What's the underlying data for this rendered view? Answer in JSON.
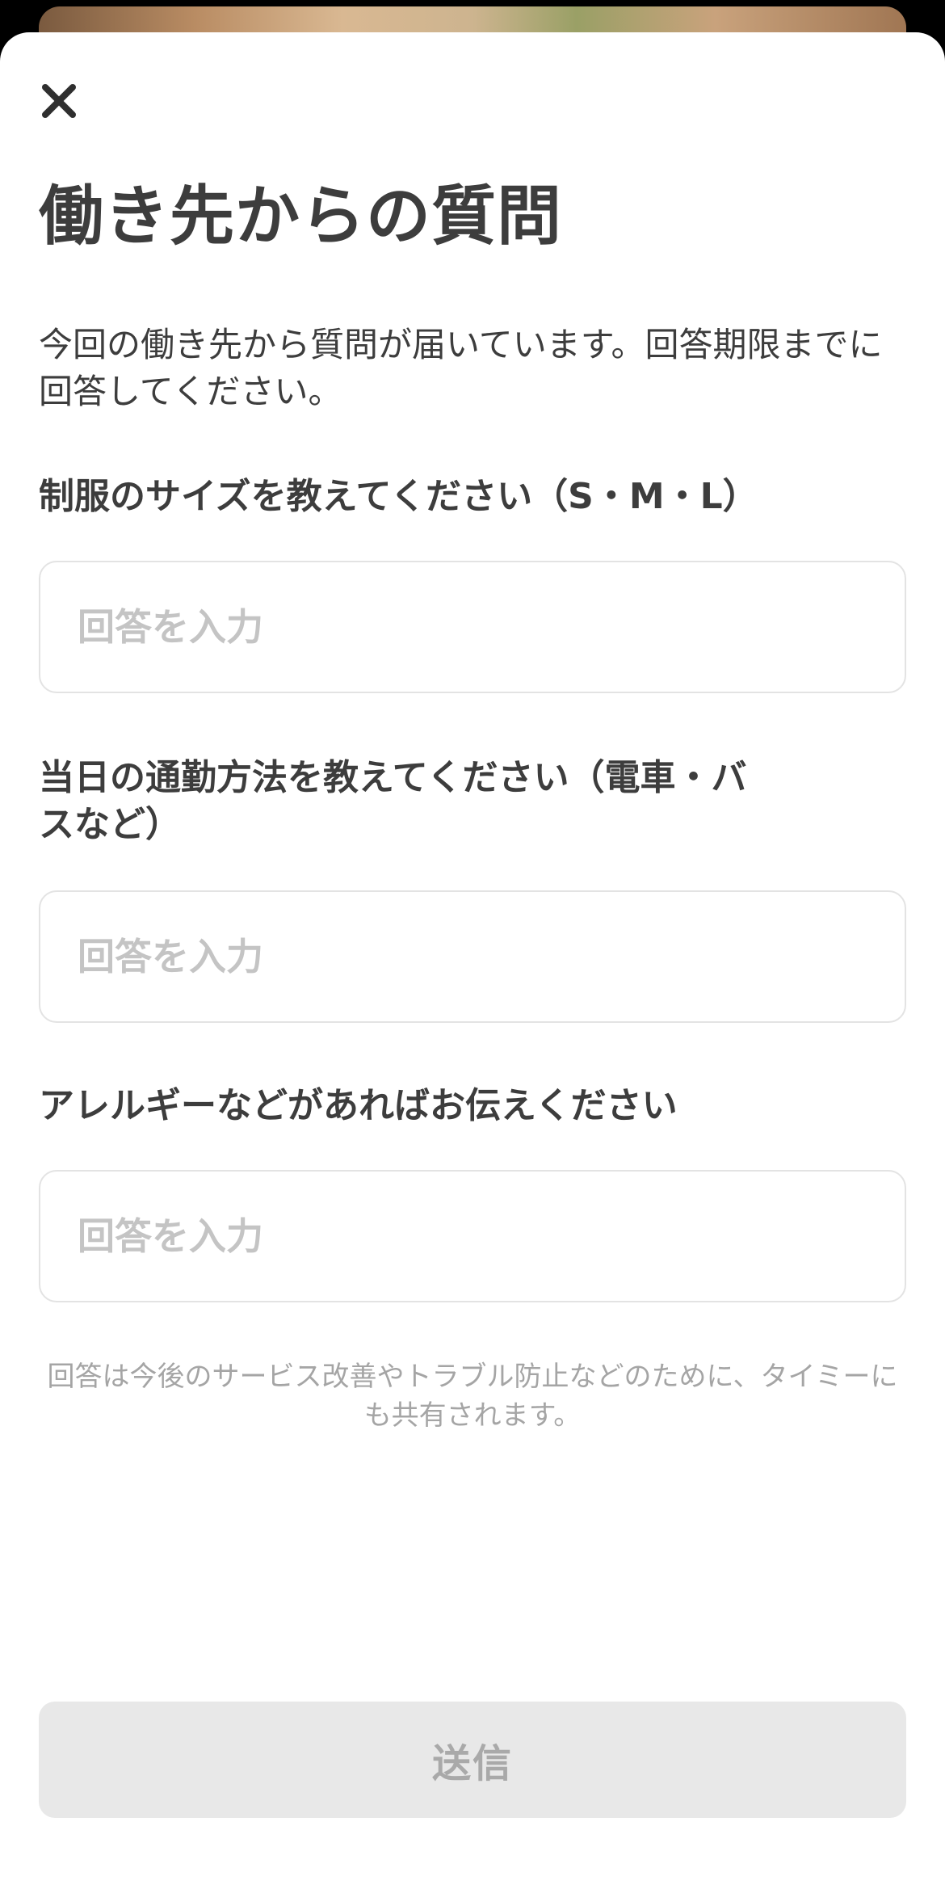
{
  "sheet": {
    "close_icon": "close-icon",
    "title": "働き先からの質問",
    "intro": "今回の働き先から質問が届いています。回答期限までに回答してください。"
  },
  "questions": [
    {
      "label": "制服のサイズを教えてください（S・M・L）",
      "placeholder": "回答を入力",
      "value": ""
    },
    {
      "label": "当日の通勤方法を教えてください（電車・バスなど）",
      "placeholder": "回答を入力",
      "value": ""
    },
    {
      "label": "アレルギーなどがあればお伝えください",
      "placeholder": "回答を入力",
      "value": ""
    }
  ],
  "notice": "回答は今後のサービス改善やトラブル防止などのために、タイミーにも共有されます。",
  "submit": {
    "label": "送信",
    "enabled": false
  },
  "colors": {
    "text": "#3d3d3d",
    "placeholder": "#c4c4c4",
    "notice": "#a5a5a5",
    "submit_bg_disabled": "#e8e8e8",
    "submit_text_disabled": "#a9a9a9",
    "border": "#e3e3e3"
  }
}
